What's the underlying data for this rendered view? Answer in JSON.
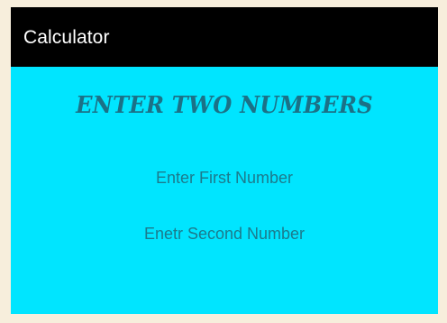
{
  "app_bar": {
    "title": "Calculator"
  },
  "main": {
    "heading": "ENTER TWO NUMBERS",
    "first_number": {
      "value": "",
      "placeholder": "Enter First Number"
    },
    "second_number": {
      "value": "",
      "placeholder": "Enetr Second Number"
    }
  },
  "colors": {
    "app_bar_background": "#000000",
    "app_bar_text": "#ffffff",
    "screen_background": "#00e5ff",
    "heading_text": "#1b7187",
    "hint_text": "#1c7a8c",
    "outer_background": "#f7eedc"
  }
}
